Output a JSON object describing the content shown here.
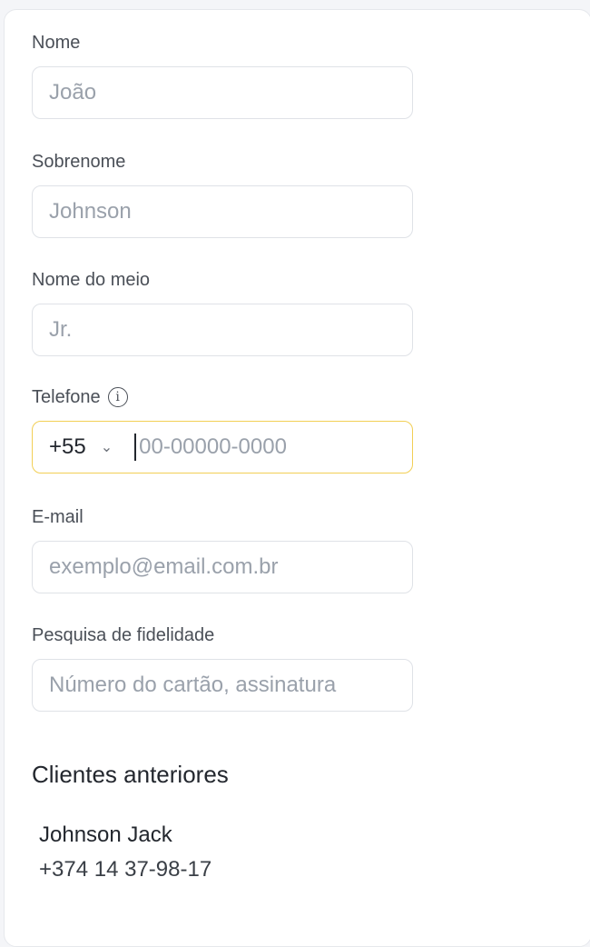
{
  "form": {
    "first_name": {
      "label": "Nome",
      "placeholder": "João"
    },
    "last_name": {
      "label": "Sobrenome",
      "placeholder": "Johnson"
    },
    "middle_name": {
      "label": "Nome do meio",
      "placeholder": "Jr."
    },
    "phone": {
      "label": "Telefone",
      "country_code": "+55",
      "placeholder": "00-00000-0000",
      "info_icon": "info-icon"
    },
    "email": {
      "label": "E-mail",
      "placeholder": "exemplo@email.com.br"
    },
    "loyalty": {
      "label": "Pesquisa de fidelidade",
      "placeholder": "Número do cartão, assinatura"
    }
  },
  "previous_clients": {
    "title": "Clientes anteriores",
    "items": [
      {
        "name": "Johnson Jack",
        "phone": "+374 14 37-98-17"
      }
    ]
  },
  "colors": {
    "focus_border": "#f2cf55",
    "placeholder": "#9aa1ab",
    "text": "#23272e"
  }
}
